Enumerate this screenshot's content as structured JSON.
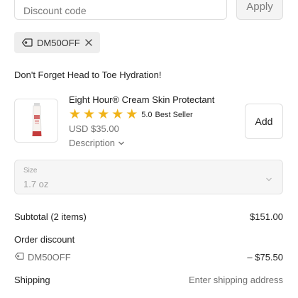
{
  "discount": {
    "placeholder": "Discount code",
    "apply_label": "Apply",
    "applied_code": "DM50OFF"
  },
  "upsell": {
    "title": "Don't Forget Head to Toe Hydration!",
    "product": {
      "name": "Eight Hour® Cream Skin Protectant",
      "rating": "5.0",
      "stars": 5,
      "badge": "Best Seller",
      "price": "USD $35.00",
      "description_label": "Description",
      "add_label": "Add"
    },
    "size": {
      "label": "Size",
      "value": "1.7 oz"
    }
  },
  "summary": {
    "subtotal_label": "Subtotal (2 items)",
    "subtotal_value": "$151.00",
    "order_discount_label": "Order discount",
    "discount_code": "DM50OFF",
    "discount_value": "– $75.50",
    "shipping_label": "Shipping",
    "shipping_value": "Enter shipping address"
  },
  "colors": {
    "star": "#f0b31a",
    "muted_text": "#707070",
    "tag_bg": "#eeeeee"
  }
}
